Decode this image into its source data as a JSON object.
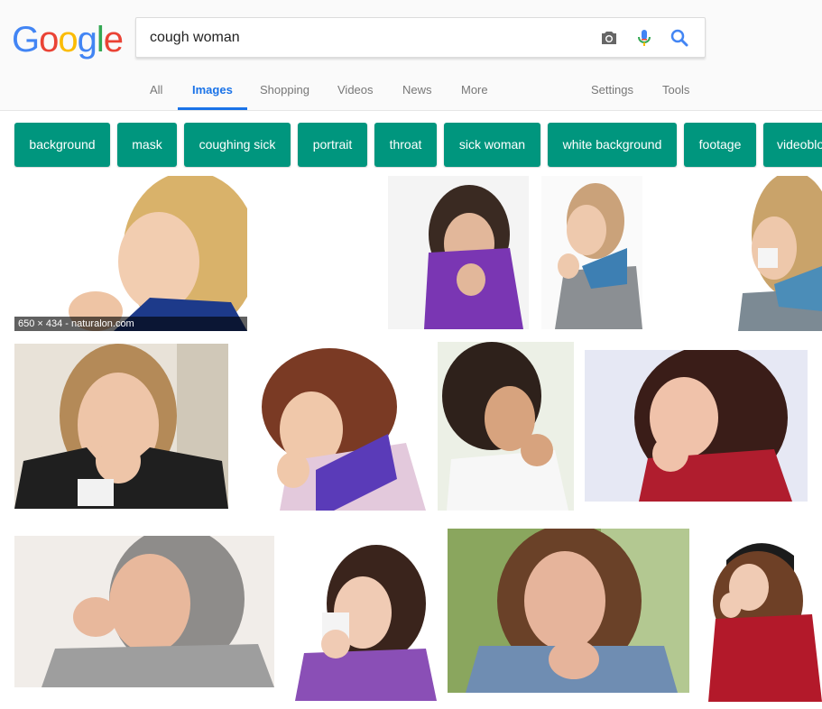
{
  "logo": {
    "letters": [
      "G",
      "o",
      "o",
      "g",
      "l",
      "e"
    ],
    "colors": [
      "#4285f4",
      "#ea4335",
      "#fbbc05",
      "#4285f4",
      "#34a853",
      "#ea4335"
    ]
  },
  "search": {
    "query": "cough woman"
  },
  "tabs": [
    {
      "label": "All"
    },
    {
      "label": "Images"
    },
    {
      "label": "Shopping"
    },
    {
      "label": "Videos"
    },
    {
      "label": "News"
    },
    {
      "label": "More"
    },
    {
      "label": "Settings"
    },
    {
      "label": "Tools"
    }
  ],
  "chips": [
    {
      "label": "background"
    },
    {
      "label": "mask"
    },
    {
      "label": "coughing sick"
    },
    {
      "label": "portrait"
    },
    {
      "label": "throat"
    },
    {
      "label": "sick woman"
    },
    {
      "label": "white background"
    },
    {
      "label": "footage"
    },
    {
      "label": "videoblocks"
    }
  ],
  "results": {
    "first_caption": "650 × 434 - naturalon.com"
  },
  "colors": {
    "accent": "#1a73e8",
    "chip": "#00967e"
  }
}
